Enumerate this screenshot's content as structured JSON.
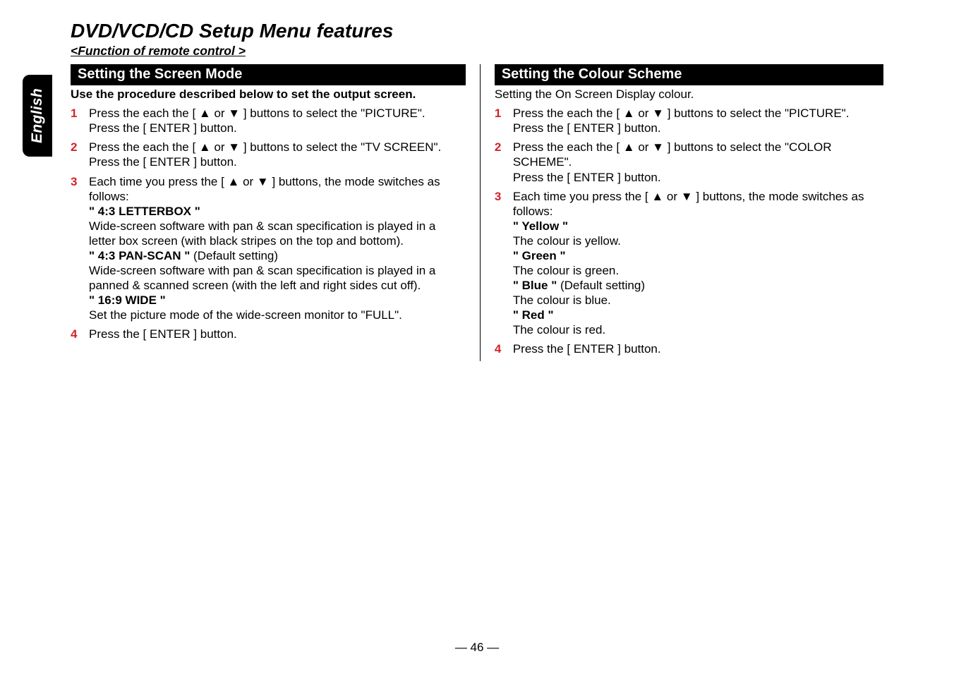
{
  "side_label": "English",
  "main_title": "DVD/VCD/CD Setup Menu features",
  "sub_title": "<Function of remote control >",
  "page_number": "— 46 —",
  "left": {
    "header": "Setting the Screen Mode",
    "intro": "Use the procedure described below to set the output screen.",
    "steps": {
      "s1": {
        "num": "1",
        "l1": "Press the each the [ ▲  or  ▼ ] buttons to select the \"PICTURE\".",
        "l2": "Press the [ ENTER ] button."
      },
      "s2": {
        "num": "2",
        "l1": "Press the each the [ ▲  or  ▼ ] buttons to select the \"TV SCREEN\".",
        "l2": "Press the [ ENTER ] button."
      },
      "s3": {
        "num": "3",
        "l1": "Each time you press the [ ▲  or  ▼ ] buttons, the mode switches as follows:",
        "o1": "\" 4:3 LETTERBOX \"",
        "o1d": "Wide-screen software with pan & scan specification is played in a letter box screen (with black stripes on the top and bottom).",
        "o2a": "\" 4:3 PAN-SCAN \" ",
        "o2b": "(Default setting)",
        "o2d": "Wide-screen software with pan & scan specification is played in a panned & scanned screen (with the left and right sides cut off).",
        "o3": "\" 16:9 WIDE \"",
        "o3d": "Set the picture mode of the wide-screen monitor to \"FULL\"."
      },
      "s4": {
        "num": "4",
        "l1": "Press the [ ENTER ] button."
      }
    }
  },
  "right": {
    "header": "Setting the Colour Scheme",
    "intro": "Setting the On Screen Display colour.",
    "steps": {
      "s1": {
        "num": "1",
        "l1": "Press the each the [ ▲  or  ▼ ] buttons to select the \"PICTURE\".",
        "l2": "Press the [ ENTER ] button."
      },
      "s2": {
        "num": "2",
        "l1": "Press the each the [ ▲  or  ▼ ] buttons to select the \"COLOR SCHEME\".",
        "l2": "Press the [ ENTER ] button."
      },
      "s3": {
        "num": "3",
        "l1": "Each time you press the [ ▲  or  ▼ ] buttons, the mode switches as follows:",
        "o1": "\" Yellow \"",
        "o1d": "The colour is yellow.",
        "o2": "\" Green \"",
        "o2d": "The colour is green.",
        "o3a": "\" Blue \" ",
        "o3b": "(Default setting)",
        "o3d": "The colour is blue.",
        "o4": "\" Red \"",
        "o4d": "The colour is red."
      },
      "s4": {
        "num": "4",
        "l1": "Press the [ ENTER ] button."
      }
    }
  }
}
